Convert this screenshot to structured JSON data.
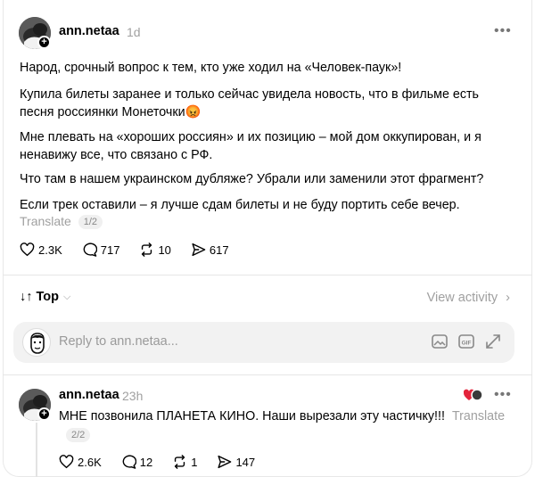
{
  "post": {
    "username": "ann.netaa",
    "time": "1d",
    "paragraphs": [
      "Народ, срочный вопрос к тем, кто уже ходил на «Человек-паук»!",
      "Купила билеты заранее и только сейчас увидела новость, что в фильме есть песня россиянки Монеточки😡",
      "Мне плевать на «хороших россиян» и их позицию – мой дом оккупирован, и я ненавижу все, что связано с РФ.",
      "Что там в нашем украинском дубляже? Убрали или заменили этот фрагмент?",
      "Если трек оставили – я лучше сдам билеты и не буду портить себе вечер."
    ],
    "translate_label": "Translate",
    "translate_pager": "1/2",
    "likes": "2.3K",
    "comments": "717",
    "reposts": "10",
    "shares": "617"
  },
  "sort": {
    "label": "Top",
    "view_activity": "View activity"
  },
  "reply_box": {
    "placeholder": "Reply to ann.netaa..."
  },
  "reply": {
    "username": "ann.netaa",
    "time": "23h",
    "text": "МНЕ позвонила ПЛАНЕТА КИНО. Наши вырезали эту частичку!!!",
    "translate_label": "Translate",
    "translate_pager": "2/2",
    "likes": "2.6K",
    "comments": "12",
    "reposts": "1",
    "shares": "147"
  },
  "icons": {
    "more": "more-dots-icon",
    "like": "heart-icon",
    "comment": "comment-bubble-icon",
    "repost": "repost-icon",
    "share": "send-icon",
    "gif": "gif-icon",
    "image": "image-icon",
    "expand": "expand-icon"
  },
  "colors": {
    "muted": "#a0a0a0",
    "reply_box_bg": "#f2f2f2"
  }
}
